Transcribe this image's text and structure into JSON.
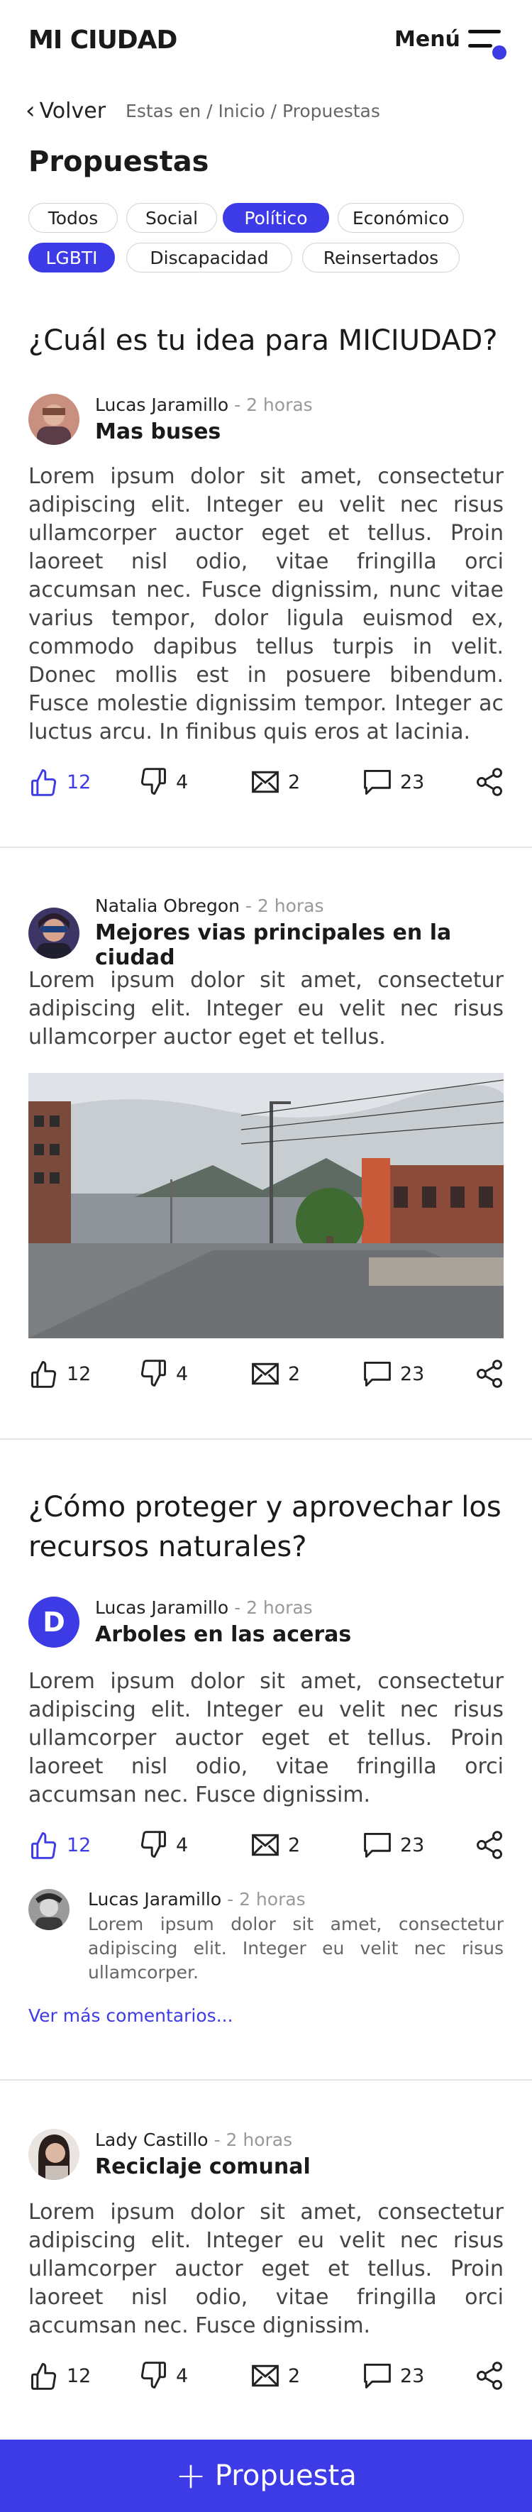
{
  "header": {
    "logo": "MI CIUDAD",
    "menu_label": "Menú"
  },
  "breadcrumb": {
    "back": "Volver",
    "path": "Estas en / Inicio / Propuestas"
  },
  "page_title": "Propuestas",
  "filters": [
    {
      "label": "Todos",
      "active": false
    },
    {
      "label": "Social",
      "active": false
    },
    {
      "label": "Político",
      "active": true
    },
    {
      "label": "Económico",
      "active": false
    },
    {
      "label": "LGBTI",
      "active": true
    },
    {
      "label": "Discapacidad",
      "active": false
    },
    {
      "label": "Reinsertados",
      "active": false
    }
  ],
  "colors": {
    "accent": "#3d3be6",
    "text": "#1a1a1a",
    "muted": "#999999"
  },
  "sections": [
    {
      "question": "¿Cuál es tu idea para MICIUDAD?"
    },
    {
      "question": "¿Cómo proteger y aprovechar los recursos naturales?"
    }
  ],
  "posts": [
    {
      "author": "Lucas Jaramillo",
      "time": "- 2 horas",
      "title": "Mas buses",
      "body": "Lorem ipsum dolor sit amet, consectetur adipiscing elit. Integer eu velit nec risus ullamcorper auctor eget et tellus. Proin laoreet nisl odio, vitae fringilla orci accumsan nec. Fusce dignissim, nunc vitae varius tempor, dolor ligula euismod ex, commodo dapibus tellus turpis in velit. Donec mollis est in posuere bibendum. Fusce molestie dignissim tempor. Integer ac luctus arcu. In finibus quis eros at lacinia.",
      "likes": "12",
      "dislikes": "4",
      "messages": "2",
      "comments": "23",
      "liked": true
    },
    {
      "author": "Natalia Obregon",
      "time": "- 2 horas",
      "title": "Mejores vias principales en la ciudad",
      "body": "Lorem ipsum dolor sit amet, consectetur adipiscing elit. Integer eu velit nec risus ullamcorper auctor eget et tellus.",
      "likes": "12",
      "dislikes": "4",
      "messages": "2",
      "comments": "23",
      "liked": false
    },
    {
      "author": "Lucas Jaramillo",
      "time": "- 2 horas",
      "title": "Arboles en las aceras",
      "avatar_letter": "D",
      "body": "Lorem ipsum dolor sit amet, consectetur adipiscing elit. Integer eu velit nec risus ullamcorper auctor eget et tellus. Proin laoreet nisl odio, vitae fringilla orci accumsan nec. Fusce dignissim.",
      "likes": "12",
      "dislikes": "4",
      "messages": "2",
      "comments": "23",
      "liked": true
    },
    {
      "author": "Lady Castillo",
      "time": "- 2 horas",
      "title": "Reciclaje comunal",
      "body": "Lorem ipsum dolor sit amet, consectetur adipiscing elit. Integer eu velit nec risus ullamcorper auctor eget et tellus. Proin laoreet nisl odio, vitae fringilla orci accumsan nec. Fusce dignissim.",
      "likes": "12",
      "dislikes": "4",
      "messages": "2",
      "comments": "23",
      "liked": false
    }
  ],
  "comment": {
    "author": "Lucas Jaramillo",
    "time": "- 2 horas",
    "text": "Lorem ipsum dolor sit amet, consectetur adipiscing elit. Integer eu velit nec risus ullamcorper.",
    "more": "Ver más comentarios..."
  },
  "cta": {
    "label": "Propuesta"
  }
}
